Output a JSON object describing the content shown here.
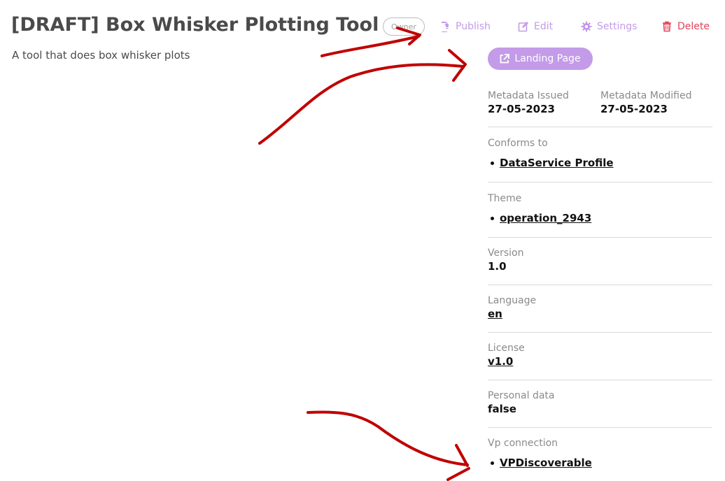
{
  "header": {
    "title": "[DRAFT] Box Whisker Plotting Tool",
    "description": "A tool that does box whisker plots",
    "owner_badge": "Owner"
  },
  "actions": {
    "publish": "Publish",
    "edit": "Edit",
    "settings": "Settings",
    "delete": "Delete",
    "landing_page": "Landing Page"
  },
  "metadata": {
    "issued": {
      "label": "Metadata Issued",
      "value": "27-05-2023"
    },
    "modified": {
      "label": "Metadata Modified",
      "value": "27-05-2023"
    },
    "conforms_to": {
      "label": "Conforms to",
      "items": [
        "DataService Profile"
      ]
    },
    "theme": {
      "label": "Theme",
      "items": [
        "operation_2943"
      ]
    },
    "version": {
      "label": "Version",
      "value": "1.0"
    },
    "language": {
      "label": "Language",
      "value": "en"
    },
    "license": {
      "label": "License",
      "value": "v1.0"
    },
    "personal_data": {
      "label": "Personal data",
      "value": "false"
    },
    "vp_connection": {
      "label": "Vp connection",
      "items": [
        "VPDiscoverable"
      ]
    }
  },
  "colors": {
    "accent": "#c39be8",
    "danger": "#e0445a",
    "annotation": "#c00000"
  }
}
